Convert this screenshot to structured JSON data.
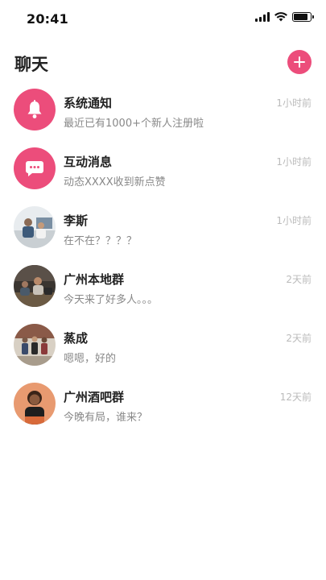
{
  "status_bar": {
    "time": "20:41",
    "battery_level": 0.85
  },
  "header": {
    "title": "聊天",
    "add_button_icon": "plus-icon"
  },
  "colors": {
    "accent": "#ec4d7b"
  },
  "chats": [
    {
      "name": "系统通知",
      "preview": "最近已有1000+个新人注册啦",
      "time": "1小时前",
      "avatar_icon": "bell-icon"
    },
    {
      "name": "互动消息",
      "preview": "动态XXXX收到新点赞",
      "time": "1小时前",
      "avatar_icon": "chat-bubble-icon"
    },
    {
      "name": "李斯",
      "preview": "在不在？？？？",
      "time": "1小时前",
      "avatar_icon": "photo-avatar"
    },
    {
      "name": "广州本地群",
      "preview": "今天来了好多人。。。",
      "time": "2天前",
      "avatar_icon": "photo-avatar"
    },
    {
      "name": "蒸成",
      "preview": "嗯嗯，好的",
      "time": "2天前",
      "avatar_icon": "photo-avatar"
    },
    {
      "name": "广州酒吧群",
      "preview": "今晚有局，谁来？",
      "time": "12天前",
      "avatar_icon": "photo-avatar"
    }
  ]
}
